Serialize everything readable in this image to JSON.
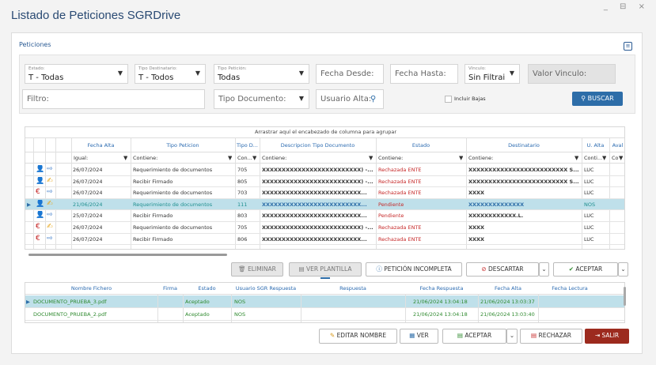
{
  "window": {
    "title": "Listado de Peticiones SGRDrive",
    "controls": "_ ⊟ ×"
  },
  "panel": {
    "title": "Peticiones"
  },
  "filters": {
    "estado": {
      "label": "Estado:",
      "value": "T - Todas"
    },
    "tipo_destinatario": {
      "label": "Tipo Destinatario:",
      "value": "T - Todos"
    },
    "tipo_peticion": {
      "label": "Tipo Petición:",
      "value": "Todas"
    },
    "fecha_desde": {
      "placeholder": "Fecha Desde:"
    },
    "fecha_hasta": {
      "placeholder": "Fecha Hasta:"
    },
    "vinculo": {
      "label": "Vínculo:",
      "value": "Sin Filtrai"
    },
    "valor_vinculo": {
      "placeholder": "Valor Vinculo:"
    },
    "filtro": {
      "placeholder": "Filtro:"
    },
    "tipo_documento": {
      "placeholder": "Tipo Documento:"
    },
    "usuario_alta": {
      "placeholder": "Usuario Alta:"
    },
    "incluir_bajas": "Incluir Bajas",
    "buscar": "BUSCAR"
  },
  "grid1": {
    "group_hint": "Arrastrar aquí el encabezado de columna para agrupar",
    "columns": [
      "Fecha Alta",
      "Tipo Peticion",
      "Tipo D...",
      "Descripcion Tipo Documento",
      "Estado",
      "Destinatario",
      "U. Alta",
      "Aval"
    ],
    "filter_labels": [
      "Igual:",
      "Contiene:",
      "Con...",
      "Contiene:",
      "Contiene:",
      "Contiene:",
      "Conti...",
      "Contiene:"
    ],
    "rows": [
      {
        "fecha": "26/07/2024",
        "tipo": "Requerimiento de documentos",
        "td": "705",
        "desc": "XXXXXXXXXXXXXXXXXXXXXXXXX) -...",
        "estado": "Rechazada ENTE",
        "dest": "XXXXXXXXXXXXXXXXXXXXXXXXX S...",
        "ualta": "LUC"
      },
      {
        "fecha": "26/07/2024",
        "tipo": "Recibir Firmado",
        "td": "805",
        "desc": "XXXXXXXXXXXXXXXXXXXXXXXXX) -...",
        "estado": "Rechazada ENTE",
        "dest": "XXXXXXXXXXXXXXXXXXXXXXXXX S...",
        "ualta": "LUC"
      },
      {
        "fecha": "26/07/2024",
        "tipo": "Requerimiento de documentos",
        "td": "703",
        "desc": "XXXXXXXXXXXXXXXXXXXXXXXXX...",
        "estado": "Rechazada ENTE",
        "dest": "XXXX",
        "ualta": "LUC"
      },
      {
        "fecha": "21/06/2024",
        "tipo": "Requerimiento de documentos",
        "td": "111",
        "desc": "XXXXXXXXXXXXXXXXXXXXXXXXX...",
        "estado": "Pendiente",
        "dest": "XXXXXXXXXXXXXX",
        "ualta": "NOS"
      },
      {
        "fecha": "25/07/2024",
        "tipo": "Recibir Firmado",
        "td": "803",
        "desc": "XXXXXXXXXXXXXXXXXXXXXXXXX...",
        "estado": "Pendiente",
        "dest": "XXXXXXXXXXXX.L.",
        "ualta": "LUC"
      },
      {
        "fecha": "26/07/2024",
        "tipo": "Requerimiento de documentos",
        "td": "705",
        "desc": "XXXXXXXXXXXXXXXXXXXXXXXXX) -...",
        "estado": "Rechazada ENTE",
        "dest": "XXXX",
        "ualta": "LUC"
      },
      {
        "fecha": "26/07/2024",
        "tipo": "Recibir Firmado",
        "td": "806",
        "desc": "XXXXXXXXXXXXXXXXXXXXXXXXX...",
        "estado": "Rechazada ENTE",
        "dest": "XXXX",
        "ualta": "LUC"
      }
    ]
  },
  "actions1": {
    "eliminar": "ELIMINAR",
    "ver_plantilla": "VER PLANTILLA",
    "peticion_incompleta": "PETICIÓN INCOMPLETA",
    "descartar": "DESCARTAR",
    "aceptar": "ACEPTAR"
  },
  "grid2": {
    "columns": [
      "Nombre Fichero",
      "Firma",
      "Estado",
      "Usuario SGR Respuesta",
      "Respuesta",
      "Fecha Respuesta",
      "Fecha Alta",
      "Fecha Lectura"
    ],
    "rows": [
      {
        "nombre": "DOCUMENTO_PRUEBA_3.pdf",
        "estado": "Aceptado",
        "usuario": "NOS",
        "fresp": "21/06/2024 13:04:18",
        "falta": "21/06/2024 13:03:37"
      },
      {
        "nombre": "DOCUMENTO_PRUEBA_2.pdf",
        "estado": "Aceptado",
        "usuario": "NOS",
        "fresp": "21/06/2024 13:04:18",
        "falta": "21/06/2024 13:03:40"
      }
    ]
  },
  "actions2": {
    "editar_nombre": "EDITAR NOMBRE",
    "ver": "VER",
    "aceptar": "ACEPTAR",
    "rechazar": "RECHAZAR",
    "salir": "SALIR"
  },
  "colors": {
    "accent": "#2d6da8",
    "selected_row": "#bfe0ea",
    "rejected": "#c62828",
    "accepted": "#2f8a2f"
  }
}
